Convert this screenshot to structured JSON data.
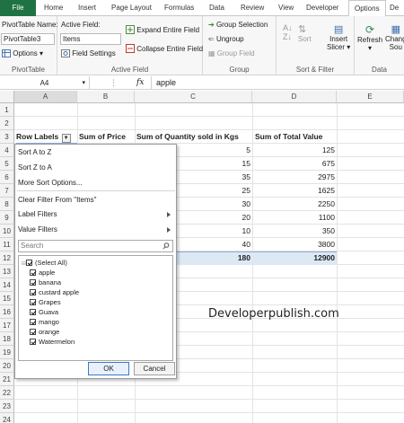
{
  "ribbon_tabs": {
    "file": "File",
    "home": "Home",
    "insert": "Insert",
    "page_layout": "Page Layout",
    "formulas": "Formulas",
    "data": "Data",
    "review": "Review",
    "view": "View",
    "developer": "Developer",
    "options": "Options",
    "design": "De"
  },
  "pivot_group": {
    "name_label": "PivotTable Name:",
    "name_value": "PivotTable3",
    "options_button": "Options",
    "group_label": "PivotTable"
  },
  "active_field_group": {
    "label": "Active Field:",
    "value": "Items",
    "field_settings": "Field Settings",
    "expand": "Expand Entire Field",
    "collapse": "Collapse Entire Field",
    "group_label": "Active Field"
  },
  "group_group": {
    "group_selection": "Group Selection",
    "ungroup": "Ungroup",
    "group_field": "Group Field",
    "group_label": "Group"
  },
  "sort_group": {
    "sort": "Sort",
    "insert_slicer_1": "Insert",
    "insert_slicer_2": "Slicer",
    "group_label": "Sort & Filter"
  },
  "data_group": {
    "refresh": "Refresh",
    "change_1": "Chang",
    "change_2": "Sou",
    "group_label": "Data"
  },
  "formula_bar": {
    "name_box": "A4",
    "fx": "fx",
    "formula": "apple"
  },
  "columns": [
    "A",
    "B",
    "C",
    "D",
    "E"
  ],
  "rows": [
    "1",
    "2",
    "3",
    "4",
    "5",
    "6",
    "7",
    "8",
    "9",
    "10",
    "11",
    "12",
    "13",
    "14",
    "15",
    "16",
    "17",
    "18",
    "19",
    "20",
    "21",
    "22",
    "23",
    "24"
  ],
  "table": {
    "headers": [
      "Row Labels",
      "Sum of Price",
      "Sum of Quantity sold in Kgs",
      "Sum of Total Value"
    ],
    "quantity": [
      "5",
      "15",
      "35",
      "25",
      "30",
      "20",
      "10",
      "40"
    ],
    "total_value": [
      "125",
      "675",
      "2975",
      "1625",
      "2250",
      "1100",
      "350",
      "3800"
    ],
    "grand_quantity": "180",
    "grand_total_value": "12900"
  },
  "filter_menu": {
    "sort_az": "Sort A to Z",
    "sort_za": "Sort Z to A",
    "more_sort": "More Sort Options...",
    "clear_filter": "Clear Filter From \"Items\"",
    "label_filters": "Label Filters",
    "value_filters": "Value Filters",
    "search_placeholder": "Search",
    "items": [
      "(Select All)",
      "apple",
      "banana",
      "custard apple",
      "Grapes",
      "Guava",
      "mango",
      "orange",
      "Watermelon"
    ],
    "ok": "OK",
    "cancel": "Cancel"
  },
  "watermark": "Developerpublish.com",
  "colors": {
    "file_tab": "#1f7244",
    "total_row": "#dde8f5"
  }
}
